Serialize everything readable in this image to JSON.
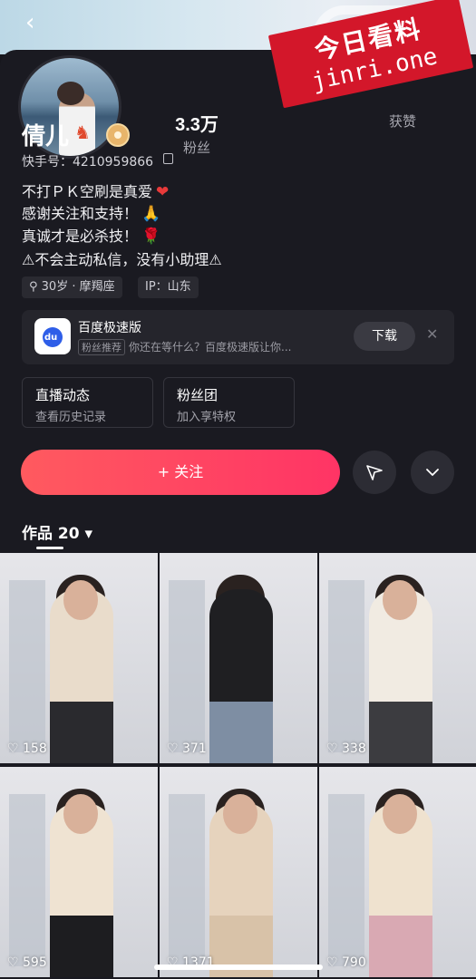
{
  "header": {
    "back_icon": "chevron-left-icon"
  },
  "watermark": {
    "line1": "今日看料",
    "line2": "jinri.one",
    "color": "#d3172a"
  },
  "profile": {
    "name": "倩儿",
    "uid": "快手号：4210959866",
    "stats": [
      {
        "value": "3.3万",
        "label": "粉丝"
      },
      {
        "value": "",
        "label": "获赞"
      }
    ],
    "bio": [
      {
        "text": "不打ＰＫ空刷是真爱",
        "emoji": "❤"
      },
      {
        "text": "感谢关注和支持！",
        "emoji": "🙏"
      },
      {
        "text": "真诚才是必杀技！",
        "emoji": "🌹"
      },
      {
        "text": "⚠不会主动私信，没有小助理⚠",
        "emoji": ""
      }
    ],
    "tags": [
      "⚲ 30岁 · 摩羯座",
      "IP：山东"
    ]
  },
  "ad": {
    "title": "百度极速版",
    "tag": "粉丝推荐",
    "subtitle": "你还在等什么？百度极速版让你...",
    "button": "下载",
    "close": "✕"
  },
  "features": [
    {
      "title": "直播动态",
      "subtitle": "查看历史记录"
    },
    {
      "title": "粉丝团",
      "subtitle": "加入享特权"
    }
  ],
  "actions": {
    "follow": "+ 关注",
    "message_icon": "send-icon",
    "more_icon": "chevron-down-icon"
  },
  "works": {
    "label": "作品 20 ▾"
  },
  "videos": [
    {
      "likes": "♡ 158",
      "outfit": "#e9dccb",
      "pants": "#2a2a2e"
    },
    {
      "likes": "♡ 371",
      "outfit": "#1f1f22",
      "pants": "#7e8ea3"
    },
    {
      "likes": "♡ 338",
      "outfit": "#f1ebe2",
      "pants": "#3c3c40"
    },
    {
      "likes": "♡ 595",
      "outfit": "#efe3d2",
      "pants": "#1d1d20"
    },
    {
      "likes": "♡ 1371",
      "outfit": "#e6d3bd",
      "pants": "#d8c2a8"
    },
    {
      "likes": "♡ 790",
      "outfit": "#efe2cf",
      "pants": "#d9a9b3"
    }
  ]
}
